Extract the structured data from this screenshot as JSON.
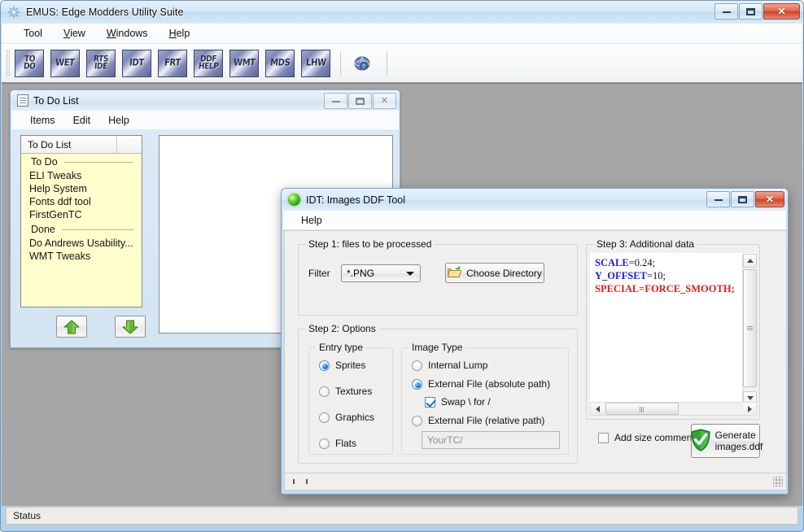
{
  "app": {
    "title": "EMUS: Edge Modders Utility Suite",
    "icon": "app-gear-icon",
    "window_controls": {
      "minimize": "minimize-icon",
      "maximize": "maximize-icon",
      "close": "close-icon"
    },
    "menus": [
      {
        "label": "Tool",
        "accel": ""
      },
      {
        "label": "View",
        "accel": "V"
      },
      {
        "label": "Windows",
        "accel": "W"
      },
      {
        "label": "Help",
        "accel": "H"
      }
    ],
    "toolbar": [
      {
        "name": "todo",
        "line1": "TO",
        "line2": "DO"
      },
      {
        "name": "wet",
        "line1": "WET",
        "line2": ""
      },
      {
        "name": "rts-ide",
        "line1": "RTS",
        "line2": "IDE"
      },
      {
        "name": "idt",
        "line1": "IDT",
        "line2": ""
      },
      {
        "name": "frt",
        "line1": "FRT",
        "line2": ""
      },
      {
        "name": "ddf-help",
        "line1": "DDF",
        "line2": "HELP"
      },
      {
        "name": "wmt",
        "line1": "WMT",
        "line2": ""
      },
      {
        "name": "mds",
        "line1": "MDS",
        "line2": ""
      },
      {
        "name": "lhw",
        "line1": "LHW",
        "line2": ""
      }
    ],
    "help_button_icon": "help-globe-icon",
    "status_text": "Status"
  },
  "todo_window": {
    "title": "To Do List",
    "icon": "document-icon",
    "menus": [
      {
        "label": "Items"
      },
      {
        "label": "Edit"
      },
      {
        "label": "Help"
      }
    ],
    "column_header": "To Do List",
    "column_header_extra": "",
    "groups": [
      {
        "label": "To Do",
        "items": [
          "ELI Tweaks",
          "Help System",
          "Fonts ddf tool",
          "FirstGenTC"
        ]
      },
      {
        "label": "Done",
        "items": [
          "Do Andrews Usability...",
          "WMT Tweaks"
        ]
      }
    ],
    "move_up_icon": "arrow-up-icon",
    "move_down_icon": "arrow-down-icon",
    "note_text": ""
  },
  "idt_dialog": {
    "title": "IDT: Images DDF Tool",
    "icon": "green-orb-icon",
    "menus": [
      {
        "label": "Help"
      }
    ],
    "step1": {
      "legend": "Step 1: files to be processed",
      "filter_label": "Filter",
      "filter_value": "*.PNG",
      "filter_options": [
        "*.PNG"
      ],
      "choose_dir_label": "Choose Directory",
      "choose_dir_icon": "open-folder-icon"
    },
    "step2": {
      "legend": "Step 2: Options",
      "entry_type": {
        "legend": "Entry type",
        "options": [
          {
            "label": "Sprites",
            "checked": true
          },
          {
            "label": "Textures",
            "checked": false
          },
          {
            "label": "Graphics",
            "checked": false
          },
          {
            "label": "Flats",
            "checked": false
          }
        ]
      },
      "image_type": {
        "legend": "Image Type",
        "options": [
          {
            "label": "Internal Lump",
            "checked": false
          },
          {
            "label": "External File (absolute path)",
            "checked": true
          },
          {
            "label": "External File (relative path)",
            "checked": false
          }
        ],
        "swap_checkbox": {
          "label": "Swap \\ for /",
          "checked": true
        },
        "relative_path_value": "",
        "relative_path_placeholder": "YourTC/"
      }
    },
    "step3": {
      "legend": "Step 3: Additional data",
      "code_lines": [
        [
          {
            "t": "SCALE",
            "c": "blue"
          },
          {
            "t": "=0.24;",
            "c": "plain"
          }
        ],
        [
          {
            "t": "Y_OFFSET",
            "c": "blue"
          },
          {
            "t": "=10;",
            "c": "plain"
          }
        ],
        [
          {
            "t": "SPECIAL=FORCE_SMOOTH;",
            "c": "red"
          }
        ]
      ],
      "scrollbar_vertical": "vertical-scrollbar",
      "scrollbar_horizontal": "horizontal-scrollbar"
    },
    "footer": {
      "add_size_comment": {
        "label": "Add size comment",
        "checked": false
      },
      "generate_label_line1": "Generate",
      "generate_label_line2": "images.ddf",
      "generate_icon": "green-shield-check-icon"
    }
  }
}
